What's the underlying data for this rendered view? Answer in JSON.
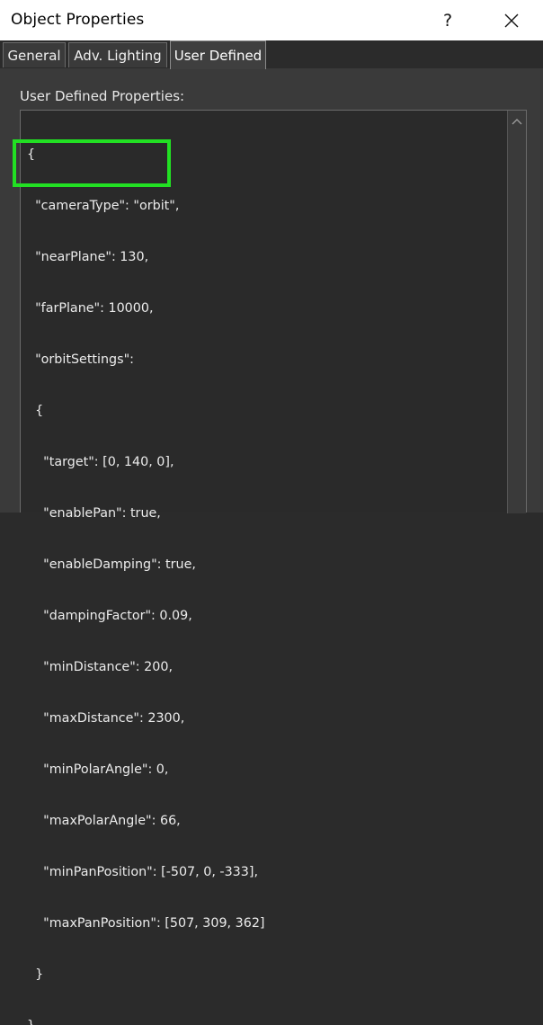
{
  "window": {
    "title": "Object Properties",
    "help_label": "?",
    "close_icon": "close-icon"
  },
  "tabs": [
    {
      "label": "General",
      "active": false
    },
    {
      "label": "Adv. Lighting",
      "active": false
    },
    {
      "label": "User Defined",
      "active": true
    }
  ],
  "panel": {
    "group_label": "User Defined Properties:"
  },
  "editor": {
    "lines": [
      "{",
      "  \"cameraType\": \"orbit\",",
      "  \"nearPlane\": 130,",
      "  \"farPlane\": 10000,",
      "  \"orbitSettings\":",
      "  {",
      "    \"target\": [0, 140, 0],",
      "    \"enablePan\": true,",
      "    \"enableDamping\": true,",
      "    \"dampingFactor\": 0.09,",
      "    \"minDistance\": 200,",
      "    \"maxDistance\": 2300,",
      "    \"minPolarAngle\": 0,",
      "    \"maxPolarAngle\": 66,",
      "    \"minPanPosition\": [-507, 0, -333],",
      "    \"maxPanPosition\": [507, 309, 362]",
      "  }",
      "}"
    ]
  },
  "annotation": {
    "color": "#22e023"
  },
  "colors": {
    "background": "#2b2b2b",
    "panel": "#3a3a3a",
    "text": "#ececec"
  }
}
